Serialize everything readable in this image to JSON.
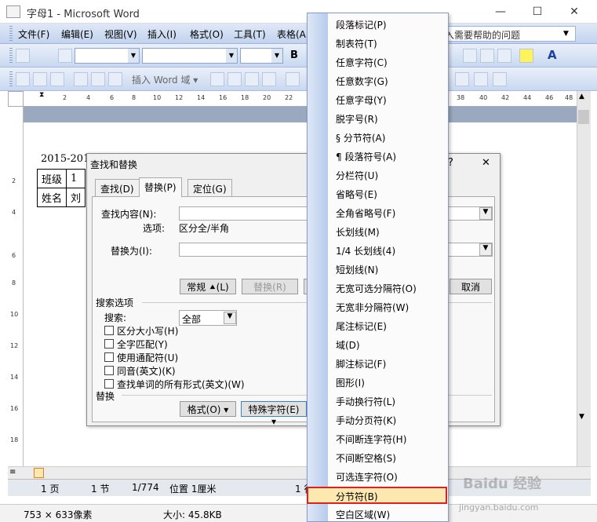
{
  "window": {
    "title": "字母1 - Microsoft Word",
    "min": "—",
    "max": "☐",
    "close": "✕"
  },
  "menubar": {
    "items": [
      "文件(F)",
      "编辑(E)",
      "视图(V)",
      "插入(I)",
      "格式(O)",
      "工具(T)",
      "表格(A"
    ],
    "ask_placeholder": "入需要帮助的问题"
  },
  "toolbar": {
    "insert_field": "插入 Word 域 ▾",
    "bold": "B"
  },
  "ruler": {
    "numbers": [
      "2",
      "4",
      "6",
      "8",
      "10",
      "12",
      "14",
      "16",
      "18",
      "20",
      "22",
      "24",
      "26",
      "28",
      "30",
      "32",
      "34",
      "36",
      "38",
      "40",
      "42",
      "44",
      "46",
      "48"
    ],
    "vnumbers": [
      "2",
      "2",
      "4",
      "6",
      "8",
      "10",
      "12",
      "14",
      "16",
      "18"
    ]
  },
  "document": {
    "line1": "2015-201",
    "cells": [
      [
        "班级",
        "1"
      ],
      [
        "姓名",
        "刘"
      ]
    ]
  },
  "dialog": {
    "title": "查找和替换",
    "help": "?",
    "close": "✕",
    "tabs": [
      "查找(D)",
      "替换(P)",
      "定位(G)"
    ],
    "find_label": "查找内容(N):",
    "options_label": "选项:",
    "options_value": "区分全/半角",
    "replace_label": "替换为(I):",
    "btn_normal": "常规 ⯅(L)",
    "btn_replace": "替换(R)",
    "btn_cancel": "取消",
    "search_options": "搜索选项",
    "search_label": "搜索:",
    "search_value": "全部",
    "checks": [
      "区分大小写(H)",
      "全字匹配(Y)",
      "使用通配符(U)",
      "同音(英文)(K)",
      "查找单词的所有形式(英文)(W)"
    ],
    "replace_section": "替换",
    "btn_format": "格式(O) ▾",
    "btn_special": "特殊字符(E) ▾"
  },
  "menu": {
    "items": [
      "段落标记(P)",
      "制表符(T)",
      "任意字符(C)",
      "任意数字(G)",
      "任意字母(Y)",
      "脱字号(R)",
      "§ 分节符(A)",
      "¶ 段落符号(A)",
      "分栏符(U)",
      "省略号(E)",
      "全角省略号(F)",
      "长划线(M)",
      "1/4 长划线(4)",
      "短划线(N)",
      "无宽可选分隔符(O)",
      "无宽非分隔符(W)",
      "尾注标记(E)",
      "域(D)",
      "脚注标记(F)",
      "图形(I)",
      "手动换行符(L)",
      "手动分页符(K)",
      "不间断连字符(H)",
      "不间断空格(S)",
      "可选连字符(O)",
      "分节符(B)",
      "空白区域(W)"
    ],
    "highlight": "分节符(B)"
  },
  "status": {
    "page": "1 页",
    "section": "1 节",
    "pages": "1/774",
    "position": "位置 1厘米",
    "line": "1 行"
  },
  "footer": {
    "dims": "753 × 633像素",
    "size": "大小: 45.8KB",
    "watermark": "Baidu 经验",
    "url": "jingyan.baidu.com"
  },
  "colors": {
    "highlight_border": "#e02020",
    "highlight_bg": "#fde8b0",
    "menubar": "#c2d3ee"
  }
}
